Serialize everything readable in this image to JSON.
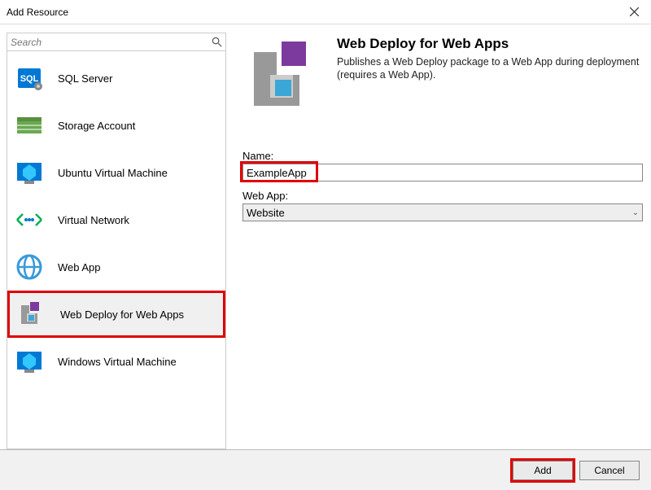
{
  "window": {
    "title": "Add Resource"
  },
  "search": {
    "placeholder": "Search"
  },
  "resources": {
    "items": [
      {
        "id": "sql-server",
        "label": "SQL Server"
      },
      {
        "id": "storage-account",
        "label": "Storage Account"
      },
      {
        "id": "ubuntu-vm",
        "label": "Ubuntu Virtual Machine"
      },
      {
        "id": "virtual-network",
        "label": "Virtual Network"
      },
      {
        "id": "web-app",
        "label": "Web App"
      },
      {
        "id": "web-deploy",
        "label": "Web Deploy for Web Apps"
      },
      {
        "id": "windows-vm",
        "label": "Windows Virtual Machine"
      }
    ]
  },
  "detail": {
    "title": "Web Deploy for Web Apps",
    "description": "Publishes a Web Deploy package to a Web App during deployment (requires a Web App).",
    "name_label": "Name:",
    "name_value": "ExampleApp",
    "webapp_label": "Web App:",
    "webapp_value": "Website"
  },
  "buttons": {
    "add": "Add",
    "cancel": "Cancel"
  }
}
